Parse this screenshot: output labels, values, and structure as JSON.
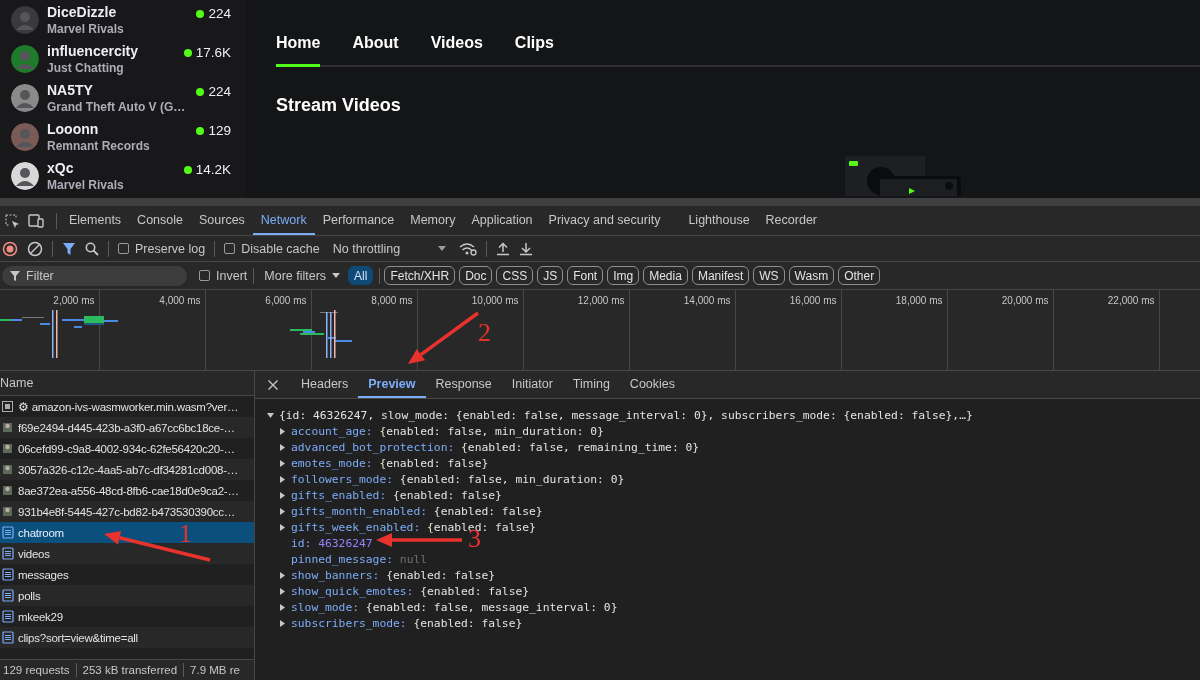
{
  "sidebar": {
    "channels": [
      {
        "name": "DiceDizzle",
        "category": "Marvel Rivals",
        "viewers": "224"
      },
      {
        "name": "influencercity",
        "category": "Just Chatting",
        "viewers": "17.6K"
      },
      {
        "name": "NA5TY",
        "category": "Grand Theft Auto V (G…",
        "viewers": "224"
      },
      {
        "name": "Looonn",
        "category": "Remnant Records",
        "viewers": "129"
      },
      {
        "name": "xQc",
        "category": "Marvel Rivals",
        "viewers": "14.2K"
      }
    ]
  },
  "channel_tabs": [
    {
      "label": "Home",
      "selected": true
    },
    {
      "label": "About",
      "selected": false
    },
    {
      "label": "Videos",
      "selected": false
    },
    {
      "label": "Clips",
      "selected": false
    }
  ],
  "section_title": "Stream Videos",
  "devtools": {
    "panel_tabs": [
      {
        "label": "Elements",
        "selected": false
      },
      {
        "label": "Console",
        "selected": false
      },
      {
        "label": "Sources",
        "selected": false
      },
      {
        "label": "Network",
        "selected": true
      },
      {
        "label": "Performance",
        "selected": false
      },
      {
        "label": "Memory",
        "selected": false
      },
      {
        "label": "Application",
        "selected": false
      },
      {
        "label": "Privacy and security",
        "selected": false
      },
      {
        "label": "Lighthouse",
        "selected": false
      },
      {
        "label": "Recorder",
        "selected": false
      }
    ],
    "toolbar": {
      "preserve_log": {
        "label": "Preserve log",
        "checked": false
      },
      "disable_cache": {
        "label": "Disable cache",
        "checked": false
      },
      "throttling": "No throttling"
    },
    "filter": {
      "placeholder": "Filter",
      "invert": {
        "label": "Invert",
        "checked": false
      },
      "more_filters": "More filters",
      "types": [
        {
          "label": "All",
          "selected": true
        },
        {
          "label": "Fetch/XHR",
          "selected": false
        },
        {
          "label": "Doc",
          "selected": false
        },
        {
          "label": "CSS",
          "selected": false
        },
        {
          "label": "JS",
          "selected": false
        },
        {
          "label": "Font",
          "selected": false
        },
        {
          "label": "Img",
          "selected": false
        },
        {
          "label": "Media",
          "selected": false
        },
        {
          "label": "Manifest",
          "selected": false
        },
        {
          "label": "WS",
          "selected": false
        },
        {
          "label": "Wasm",
          "selected": false
        },
        {
          "label": "Other",
          "selected": false
        }
      ]
    },
    "overview": {
      "ticks": [
        "2,000 ms",
        "4,000 ms",
        "6,000 ms",
        "8,000 ms",
        "10,000 ms",
        "12,000 ms",
        "14,000 ms",
        "16,000 ms",
        "18,000 ms",
        "20,000 ms",
        "22,000 ms"
      ]
    },
    "requests": {
      "column": "Name",
      "rows": [
        {
          "name": "⚙ amazon-ivs-wasmworker.min.wasm?ver…",
          "kind": "wasm",
          "selected": false
        },
        {
          "name": "f69e2494-d445-423b-a3f0-a67cc6bc18ce-…",
          "kind": "image",
          "selected": false
        },
        {
          "name": "06cefd99-c9a8-4002-934c-62fe56420c20-…",
          "kind": "image",
          "selected": false
        },
        {
          "name": "3057a326-c12c-4aa5-ab7c-df34281cd008-…",
          "kind": "image",
          "selected": false
        },
        {
          "name": "8ae372ea-a556-48cd-8fb6-cae18d0e9ca2-…",
          "kind": "image",
          "selected": false
        },
        {
          "name": "931b4e8f-5445-427c-bd82-b473530390cc…",
          "kind": "image",
          "selected": false
        },
        {
          "name": "chatroom",
          "kind": "document",
          "selected": true
        },
        {
          "name": "videos",
          "kind": "document",
          "selected": false
        },
        {
          "name": "messages",
          "kind": "document",
          "selected": false
        },
        {
          "name": "polls",
          "kind": "document",
          "selected": false
        },
        {
          "name": "mkeek29",
          "kind": "document",
          "selected": false
        },
        {
          "name": "clips?sort=view&time=all",
          "kind": "document",
          "selected": false
        }
      ]
    },
    "status": [
      "129 requests",
      "253 kB transferred",
      "7.9 MB re"
    ],
    "detail": {
      "tabs": [
        {
          "label": "Headers",
          "selected": false
        },
        {
          "label": "Preview",
          "selected": true
        },
        {
          "label": "Response",
          "selected": false
        },
        {
          "label": "Initiator",
          "selected": false
        },
        {
          "label": "Timing",
          "selected": false
        },
        {
          "label": "Cookies",
          "selected": false
        }
      ],
      "root": {
        "summary": "{id: 46326247, slow_mode: {enabled: false, message_interval: 0}, subscribers_mode: {enabled: false},…}",
        "expanded": true
      },
      "properties": [
        {
          "key": "account_age:",
          "value": "{enabled: false, min_duration: 0}",
          "kind": "object",
          "expanded": false
        },
        {
          "key": "advanced_bot_protection:",
          "value": "{enabled: false, remaining_time: 0}",
          "kind": "object",
          "expanded": false
        },
        {
          "key": "emotes_mode:",
          "value": "{enabled: false}",
          "kind": "object",
          "expanded": false
        },
        {
          "key": "followers_mode:",
          "value": "{enabled: false, min_duration: 0}",
          "kind": "object",
          "expanded": false
        },
        {
          "key": "gifts_enabled:",
          "value": "{enabled: false}",
          "kind": "object",
          "expanded": false
        },
        {
          "key": "gifts_month_enabled:",
          "value": "{enabled: false}",
          "kind": "object",
          "expanded": false
        },
        {
          "key": "gifts_week_enabled:",
          "value": "{enabled: false}",
          "kind": "object",
          "expanded": false
        },
        {
          "key": "id:",
          "value": "46326247",
          "kind": "number"
        },
        {
          "key": "pinned_message:",
          "value": "null",
          "kind": "null"
        },
        {
          "key": "show_banners:",
          "value": "{enabled: false}",
          "kind": "object",
          "expanded": false
        },
        {
          "key": "show_quick_emotes:",
          "value": "{enabled: false}",
          "kind": "object",
          "expanded": false
        },
        {
          "key": "slow_mode:",
          "value": "{enabled: false, message_interval: 0}",
          "kind": "object",
          "expanded": false
        },
        {
          "key": "subscribers_mode:",
          "value": "{enabled: false}",
          "kind": "object",
          "expanded": false
        }
      ]
    }
  },
  "annotations": [
    {
      "label": "1"
    },
    {
      "label": "2"
    },
    {
      "label": "3"
    }
  ]
}
